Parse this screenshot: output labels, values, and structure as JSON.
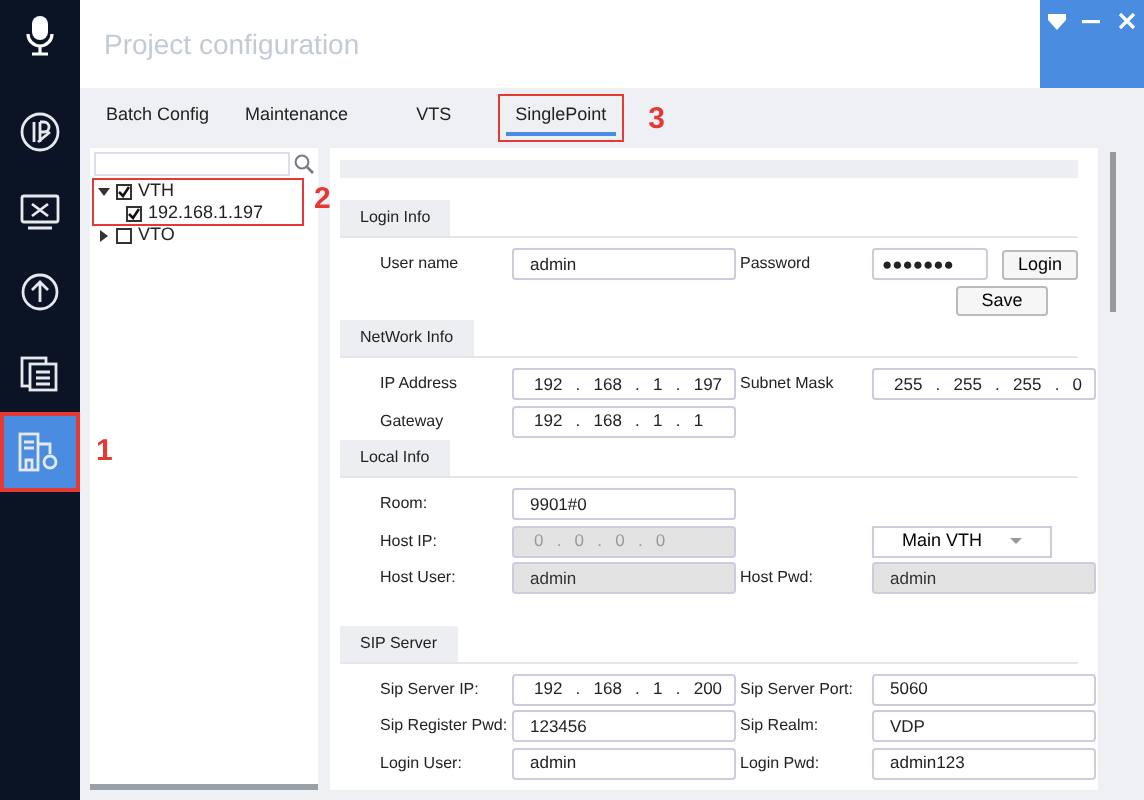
{
  "sidebar": {
    "logo": {
      "kind": "mic"
    },
    "items": [
      {
        "kind": "ip",
        "selected": false,
        "highlighted": false
      },
      {
        "kind": "tools",
        "selected": false,
        "highlighted": false
      },
      {
        "kind": "upload",
        "selected": false,
        "highlighted": false
      },
      {
        "kind": "list",
        "selected": false,
        "highlighted": false
      },
      {
        "kind": "building",
        "selected": true,
        "highlighted": true,
        "callout": "1"
      }
    ]
  },
  "window": {
    "title": "Project configuration",
    "controls": [
      {
        "kind": "shield"
      },
      {
        "kind": "minimize"
      },
      {
        "kind": "close"
      }
    ]
  },
  "tabs": [
    {
      "label": "Batch Config",
      "selected": false,
      "highlighted": false
    },
    {
      "label": "Maintenance",
      "selected": false,
      "highlighted": false
    },
    {
      "label": "VTS",
      "selected": false,
      "highlighted": false
    },
    {
      "label": "SinglePoint",
      "selected": true,
      "highlighted": true,
      "callout": "3"
    }
  ],
  "tree": {
    "nodes": [
      {
        "label": "VTH",
        "expanded": true,
        "checked": true,
        "highlighted": true,
        "callout": "2",
        "children": [
          {
            "label": "192.168.1.197",
            "checked": true
          }
        ]
      },
      {
        "label": "VTO",
        "expanded": false,
        "checked": false
      }
    ]
  },
  "sections": [
    {
      "title": "Login Info",
      "rows": [
        [
          {
            "kind": "label",
            "text": "User name"
          },
          {
            "kind": "text",
            "value": "admin"
          },
          {
            "kind": "label",
            "text": "Password"
          },
          {
            "kind": "password",
            "value": "●●●●●●●"
          },
          {
            "kind": "button",
            "text": "Login"
          }
        ],
        [
          {
            "kind": "button",
            "text": "Save"
          }
        ]
      ]
    },
    {
      "title": "NetWork Info",
      "rows": [
        [
          {
            "kind": "label",
            "text": "IP Address"
          },
          {
            "kind": "ip",
            "octets": [
              "192",
              "168",
              "1",
              "197"
            ],
            "separator": "."
          },
          {
            "kind": "label",
            "text": "Subnet Mask"
          },
          {
            "kind": "ip",
            "octets": [
              "255",
              "255",
              "255",
              "0"
            ],
            "separator": "."
          }
        ],
        [
          {
            "kind": "label",
            "text": "Gateway"
          },
          {
            "kind": "ip",
            "octets": [
              "192",
              "168",
              "1",
              "1"
            ],
            "separator": "."
          }
        ]
      ]
    },
    {
      "title": "Local Info",
      "rows": [
        [
          {
            "kind": "label",
            "text": "Room:"
          },
          {
            "kind": "text",
            "value": "9901#0"
          }
        ],
        [
          {
            "kind": "label",
            "text": "Host IP:"
          },
          {
            "kind": "ip",
            "octets": [
              "0",
              "0",
              "0",
              "0"
            ],
            "separator": ".",
            "disabled": true
          },
          {
            "kind": "spacer"
          },
          {
            "kind": "select",
            "value": "Main VTH"
          }
        ],
        [
          {
            "kind": "label",
            "text": "Host User:"
          },
          {
            "kind": "text",
            "value": "admin",
            "disabled": true
          },
          {
            "kind": "label",
            "text": "Host Pwd:"
          },
          {
            "kind": "text",
            "value": "admin",
            "disabled": true
          }
        ]
      ]
    },
    {
      "title": "SIP Server",
      "rows": [
        [
          {
            "kind": "label",
            "text": "Sip Server IP:"
          },
          {
            "kind": "ip",
            "octets": [
              "192",
              "168",
              "1",
              "200"
            ],
            "separator": "."
          },
          {
            "kind": "label",
            "text": "Sip Server Port:"
          },
          {
            "kind": "text",
            "value": "5060"
          }
        ],
        [
          {
            "kind": "label",
            "text": "Sip Register Pwd:"
          },
          {
            "kind": "text",
            "value": "123456"
          },
          {
            "kind": "label",
            "text": "Sip Realm:"
          },
          {
            "kind": "text",
            "value": "VDP"
          }
        ],
        [
          {
            "kind": "label",
            "text": "Login User:"
          },
          {
            "kind": "text",
            "value": "admin"
          },
          {
            "kind": "label",
            "text": "Login Pwd:"
          },
          {
            "kind": "text",
            "value": "admin123"
          }
        ]
      ]
    }
  ]
}
